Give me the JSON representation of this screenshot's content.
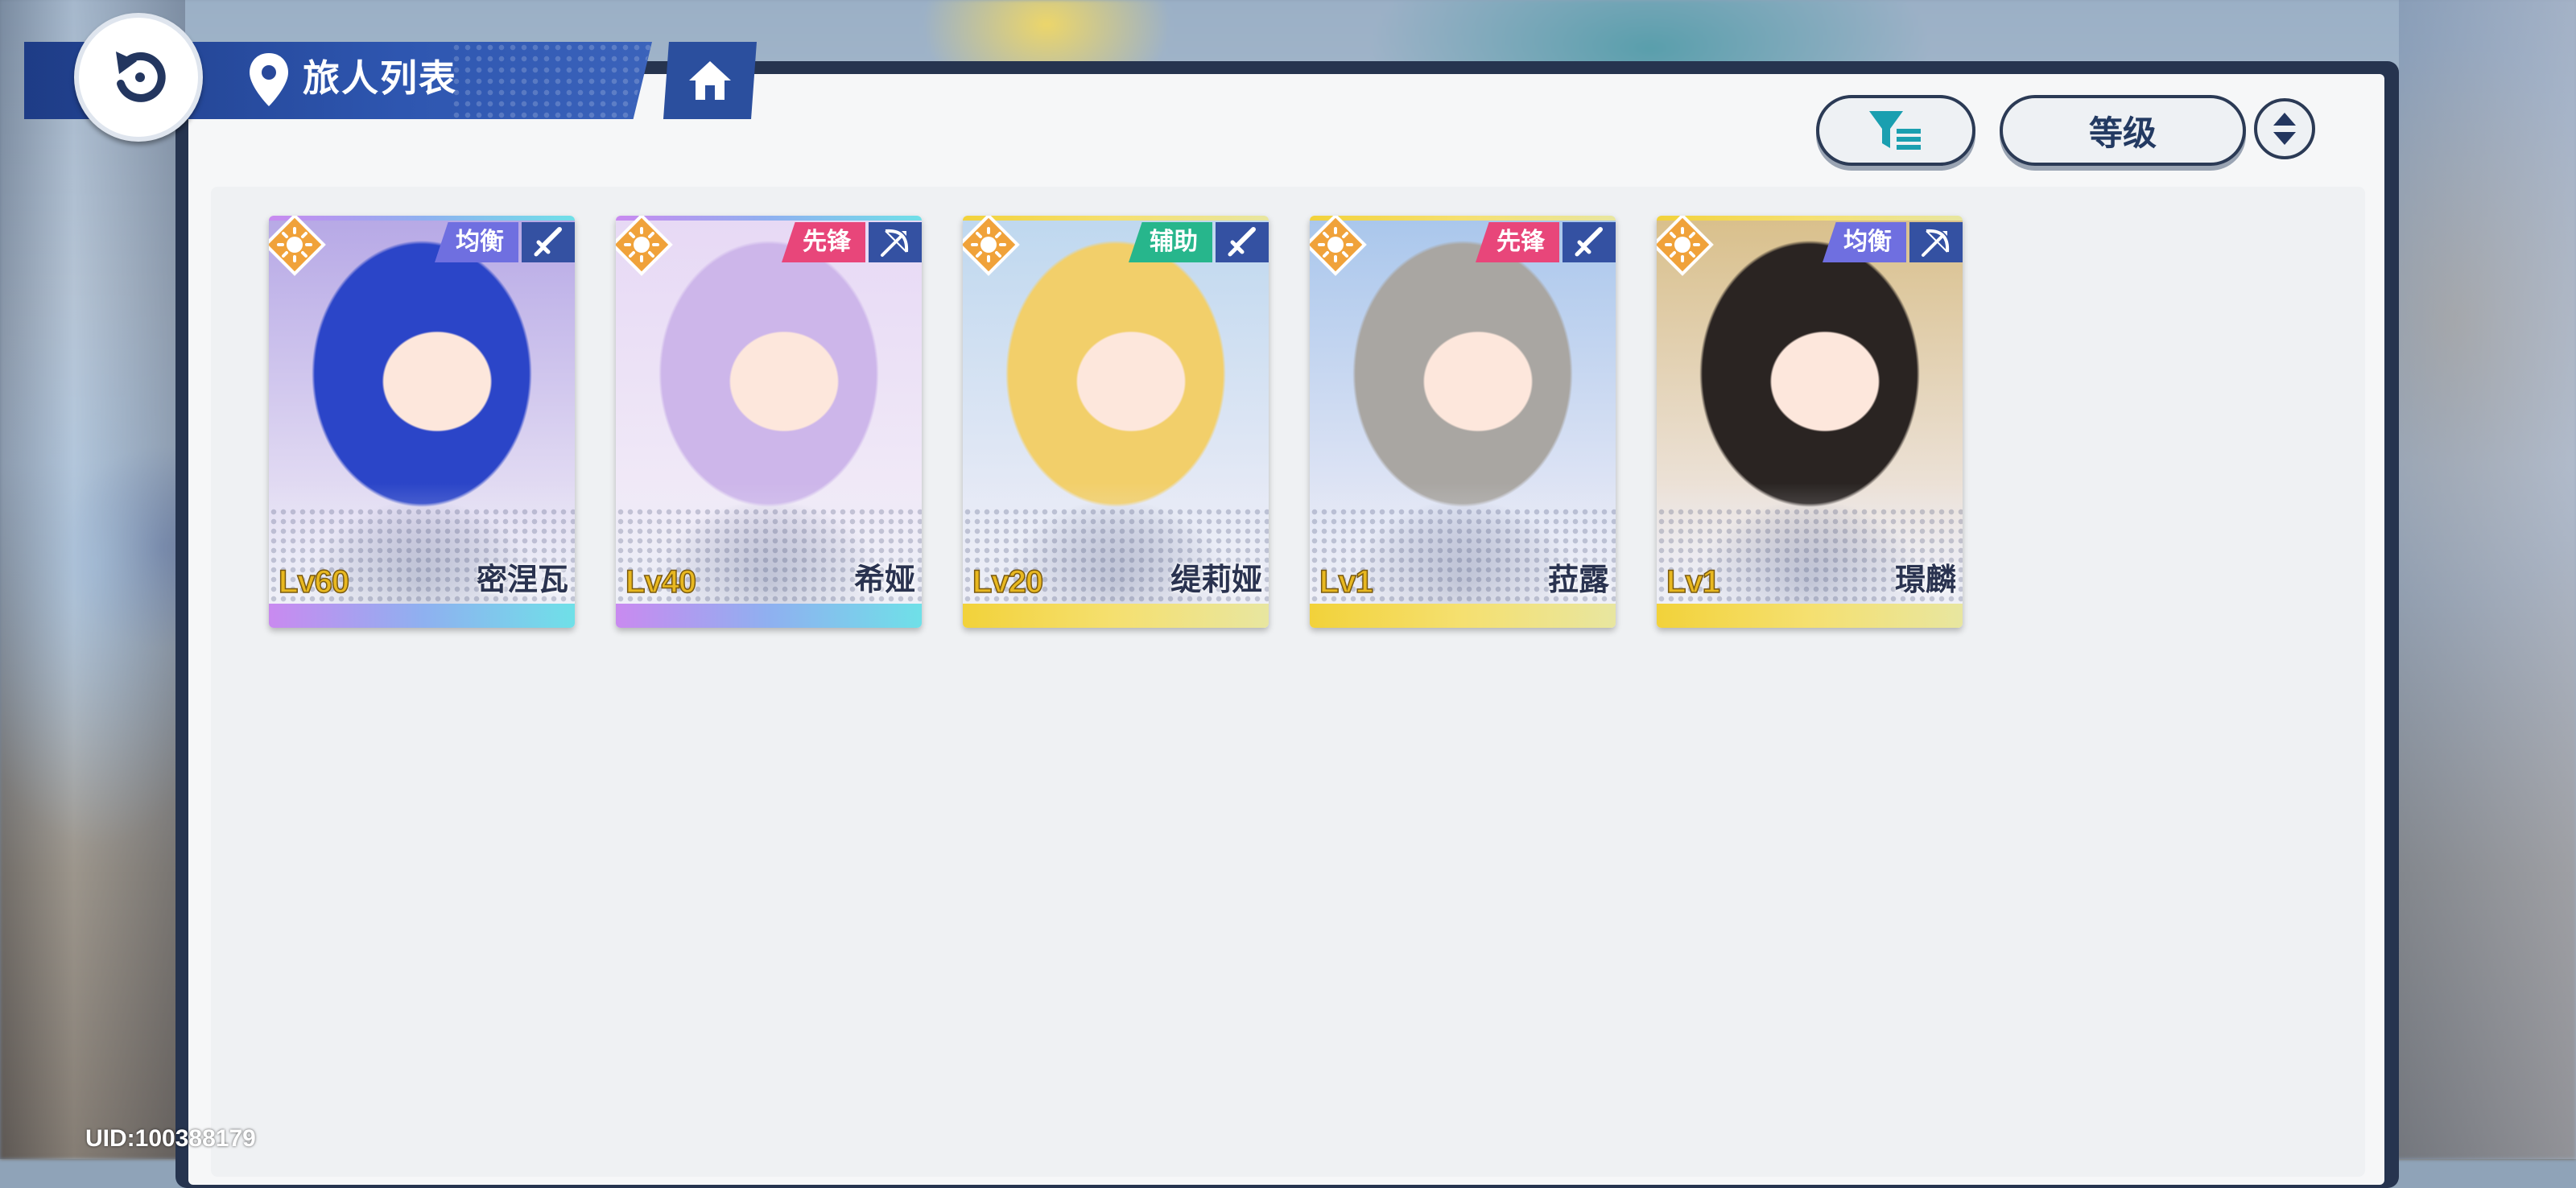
{
  "header": {
    "title": "旅人列表",
    "back_icon": "back-arrow-icon",
    "location_icon": "location-pin-icon",
    "home_icon": "home-icon"
  },
  "controls": {
    "filter_icon": "filter-list-icon",
    "sort_label": "等级",
    "sort_order_icon": "sort-toggle-icon"
  },
  "travelers": [
    {
      "name": "密涅瓦",
      "level": "Lv60",
      "role": "均衡",
      "role_color": "#6f6fe0",
      "weapon": "sword",
      "element": "sun",
      "rarity": "purple",
      "hair": "#2b45c8",
      "bg": "#b7a9e6"
    },
    {
      "name": "希娅",
      "level": "Lv40",
      "role": "先锋",
      "role_color": "#e8467a",
      "weapon": "bow",
      "element": "sun",
      "rarity": "purple",
      "hair": "#cdb6ea",
      "bg": "#e7d9f5"
    },
    {
      "name": "缇莉娅",
      "level": "Lv20",
      "role": "辅助",
      "role_color": "#27b68c",
      "weapon": "sword",
      "element": "sun",
      "rarity": "gold",
      "hair": "#f2cf6a",
      "bg": "#bfd8ef"
    },
    {
      "name": "菈露",
      "level": "Lv1",
      "role": "先锋",
      "role_color": "#e8467a",
      "weapon": "sword",
      "element": "sun",
      "rarity": "gold",
      "hair": "#a9a6a2",
      "bg": "#aac7ec"
    },
    {
      "name": "璟麟",
      "level": "Lv1",
      "role": "均衡",
      "role_color": "#6f6fe0",
      "weapon": "bow",
      "element": "sun",
      "rarity": "gold",
      "hair": "#2a2422",
      "bg": "#d9c08c"
    }
  ],
  "footer": {
    "uid": "UID:100388179"
  }
}
